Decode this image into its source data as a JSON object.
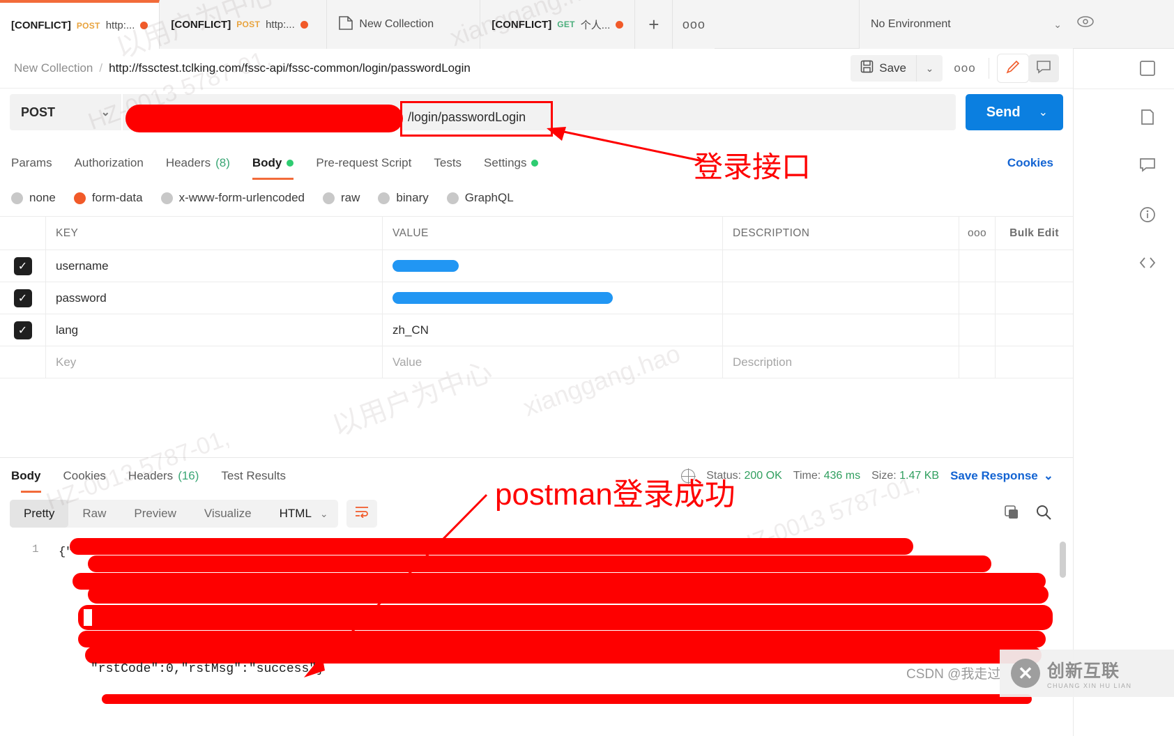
{
  "app": {
    "name": "Postman"
  },
  "tabbar": {
    "tabs": [
      {
        "conflict": "[CONFLICT]",
        "method": "POST",
        "method_class": "post",
        "title": "http:...",
        "unsaved": true,
        "active": true
      },
      {
        "conflict": "[CONFLICT]",
        "method": "POST",
        "method_class": "post",
        "title": "http:...",
        "unsaved": true,
        "active": false
      },
      {
        "conflict": "",
        "method": "",
        "method_class": "",
        "title": "New Collection",
        "unsaved": false,
        "active": false
      },
      {
        "conflict": "[CONFLICT]",
        "method": "GET",
        "method_class": "get",
        "title": "个人...",
        "unsaved": true,
        "active": false
      }
    ],
    "new_tab_label": "+",
    "more_label": "ooo",
    "environment": "No Environment"
  },
  "breadcrumb": {
    "collection": "New Collection",
    "separator": "/",
    "request_url": "http://fssctest.tclking.com/fssc-api/fssc-common/login/passwordLogin",
    "save_label": "Save",
    "save_caret": "⌄",
    "more_label": "ooo"
  },
  "request": {
    "method": "POST",
    "method_caret": "⌄",
    "url_visible_fragment": "/login/passwordLogin",
    "url_redacted": true,
    "send_label": "Send",
    "send_caret": "⌄",
    "cookies_label": "Cookies",
    "tabs": [
      {
        "label": "Params",
        "active": false,
        "badge": "",
        "dot": false
      },
      {
        "label": "Authorization",
        "active": false,
        "badge": "",
        "dot": false
      },
      {
        "label": "Headers",
        "active": false,
        "badge": "(8)",
        "dot": false
      },
      {
        "label": "Body",
        "active": true,
        "badge": "",
        "dot": true
      },
      {
        "label": "Pre-request Script",
        "active": false,
        "badge": "",
        "dot": false
      },
      {
        "label": "Tests",
        "active": false,
        "badge": "",
        "dot": false
      },
      {
        "label": "Settings",
        "active": false,
        "badge": "",
        "dot": true
      }
    ],
    "body_types": [
      {
        "label": "none",
        "selected": false
      },
      {
        "label": "form-data",
        "selected": true
      },
      {
        "label": "x-www-form-urlencoded",
        "selected": false
      },
      {
        "label": "raw",
        "selected": false
      },
      {
        "label": "binary",
        "selected": false
      },
      {
        "label": "GraphQL",
        "selected": false
      }
    ],
    "table": {
      "headers": {
        "key": "KEY",
        "value": "VALUE",
        "description": "DESCRIPTION",
        "more": "ooo",
        "bulk_edit": "Bulk Edit"
      },
      "rows": [
        {
          "checked": true,
          "key": "username",
          "value": "",
          "value_redacted": true,
          "redact_width": 95,
          "description": ""
        },
        {
          "checked": true,
          "key": "password",
          "value": "",
          "value_redacted": true,
          "redact_width": 316,
          "description": ""
        },
        {
          "checked": true,
          "key": "lang",
          "value": "zh_CN",
          "value_redacted": false,
          "redact_width": 0,
          "description": ""
        }
      ],
      "new_row": {
        "key_placeholder": "Key",
        "value_placeholder": "Value",
        "description_placeholder": "Description"
      }
    }
  },
  "response": {
    "tabs": [
      {
        "label": "Body",
        "active": true,
        "badge": ""
      },
      {
        "label": "Cookies",
        "active": false,
        "badge": ""
      },
      {
        "label": "Headers",
        "active": false,
        "badge": "(16)"
      },
      {
        "label": "Test Results",
        "active": false,
        "badge": ""
      }
    ],
    "status_label": "Status:",
    "status_value": "200 OK",
    "time_label": "Time:",
    "time_value": "436 ms",
    "size_label": "Size:",
    "size_value": "1.47 KB",
    "save_response_label": "Save Response",
    "save_response_caret": "⌄",
    "format_tabs": [
      {
        "label": "Pretty",
        "active": true
      },
      {
        "label": "Raw",
        "active": false
      },
      {
        "label": "Preview",
        "active": false
      },
      {
        "label": "Visualize",
        "active": false
      }
    ],
    "language": "HTML",
    "language_caret": "⌄",
    "line_number": "1",
    "body_visible_text": "\"rstCode\":0,\"rstMsg\":\"success\"}",
    "body_redacted": true
  },
  "annotations": [
    {
      "id": "login-api",
      "text": "登录接口",
      "color": "#fe0000"
    },
    {
      "id": "login-success",
      "text": "postman登录成功",
      "color": "#fe0000"
    }
  ],
  "watermarks": {
    "csdn": "CSDN @我走过",
    "brand_main": "创新互联",
    "brand_sub": "CHUANG XIN HU LIAN",
    "bg_1": "以用户为中心",
    "bg_2": "xianggang.hao",
    "bg_3": "HZ-0013 5787-01,"
  },
  "colors": {
    "accent": "#f26b3a",
    "send_blue": "#0b7fe0",
    "link_blue": "#1263d2",
    "success_green": "#2f9e5e",
    "redact_red": "#fe0000",
    "redact_blue": "#2196f3"
  }
}
